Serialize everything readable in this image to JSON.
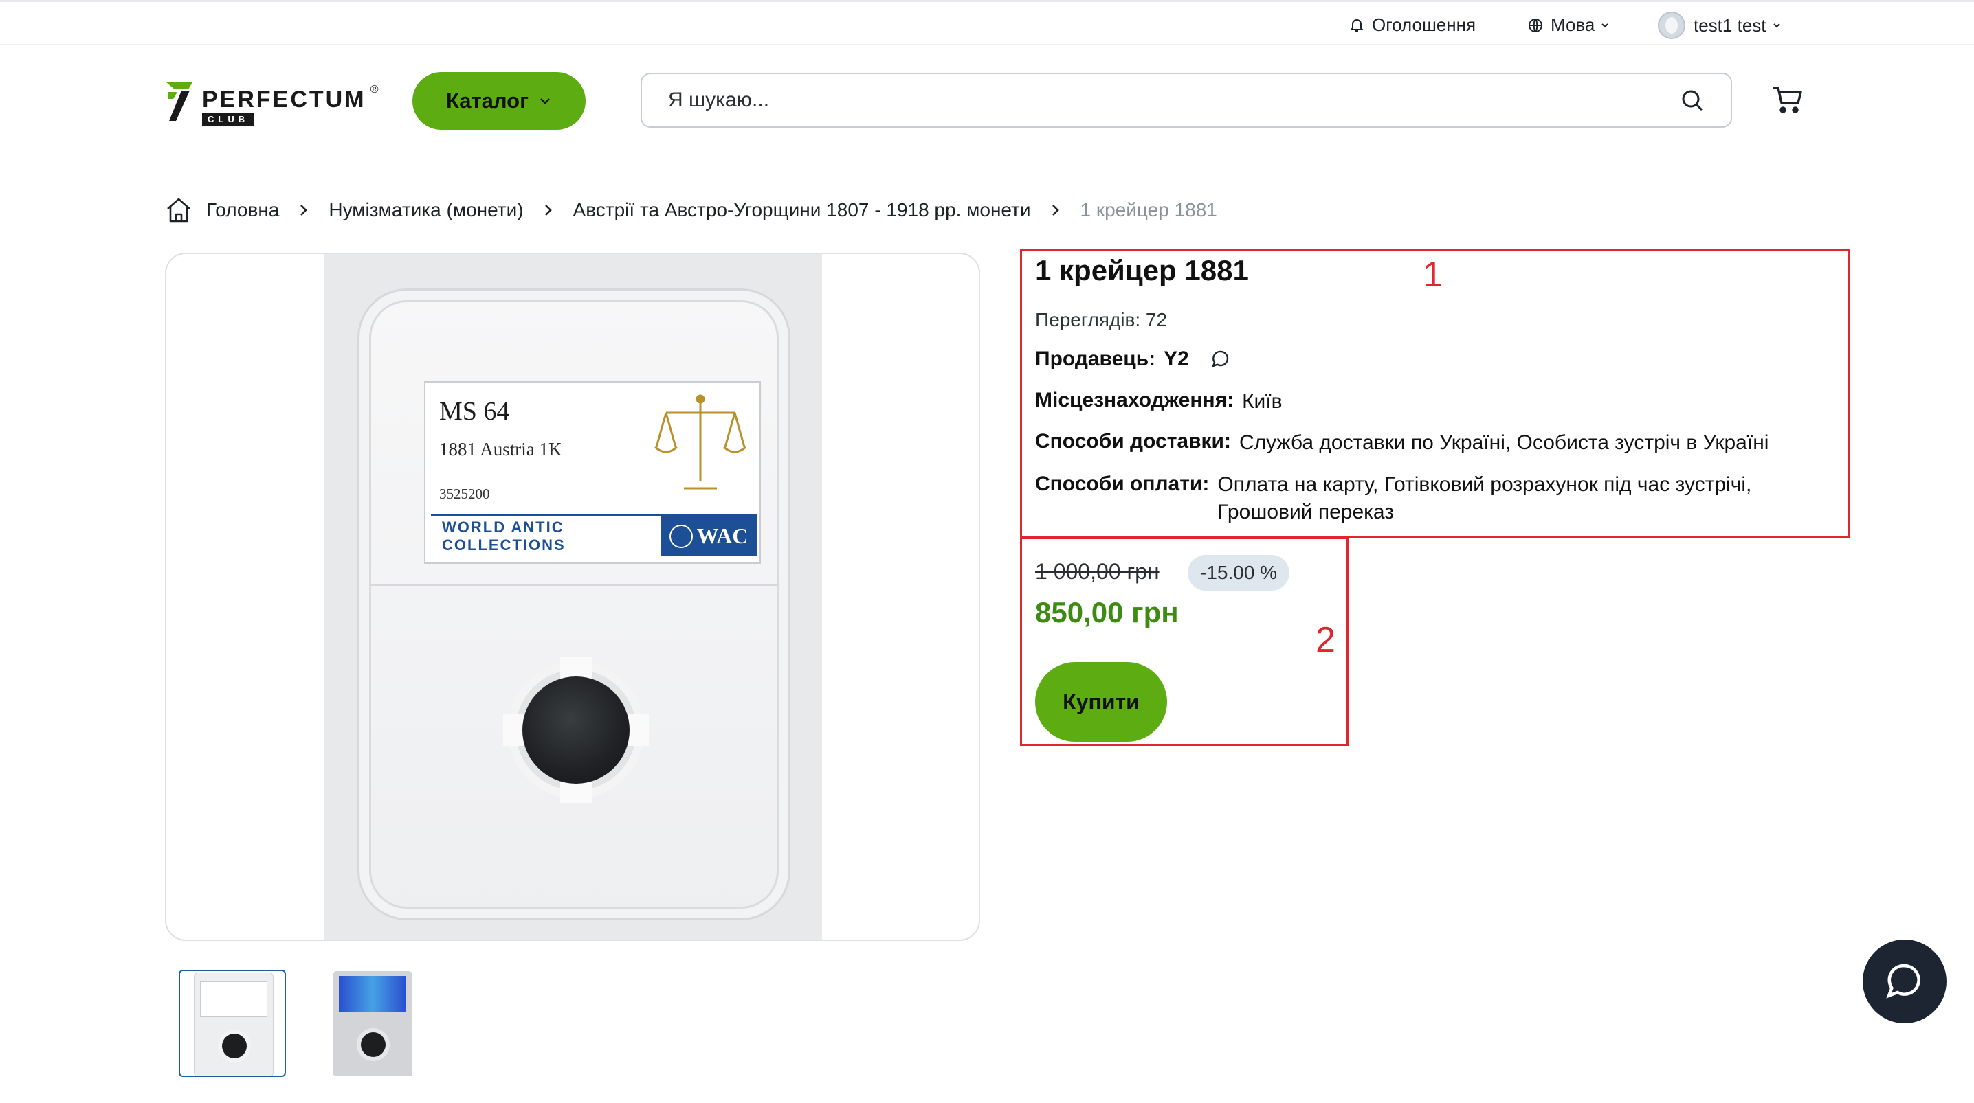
{
  "topbar": {
    "announcements": "Оголошення",
    "language": "Мова",
    "user": "test1 test"
  },
  "header": {
    "logo_word": "PERFECTUM",
    "logo_sub": "CLUB",
    "logo_reg": "®",
    "catalog_label": "Каталог",
    "search_placeholder": "Я шукаю..."
  },
  "breadcrumb": {
    "items": [
      "Головна",
      "Нумізматика (монети)",
      "Австрії та Австро-Угорщини 1807 - 1918 рр. монети",
      "1 крейцер 1881"
    ]
  },
  "gallery": {
    "slab_grade": "MS 64",
    "slab_coin": "1881 Austria 1K",
    "slab_cert": "3525200",
    "slab_band": "WORLD ANTIC COLLECTIONS",
    "slab_brand": "WAC"
  },
  "product": {
    "title": "1 крейцер 1881",
    "views": "Переглядів: 72",
    "seller_label": "Продавець:",
    "seller_value": "Y2",
    "location_label": "Місцезнаходження:",
    "location_value": "Київ",
    "delivery_label": "Способи доставки:",
    "delivery_value": "Служба доставки по Україні, Особиста зустріч в Україні",
    "payment_label": "Способи оплати:",
    "payment_line1": "Оплата на карту, Готівковий розрахунок під час зустрічі,",
    "payment_line2": "Грошовий переказ",
    "old_price": "1 000,00 грн",
    "discount": "-15.00 %",
    "new_price": "850,00 грн",
    "buy_label": "Купити"
  },
  "annotations": {
    "box1": "1",
    "box2": "2",
    "color": "#e0262f"
  },
  "colors": {
    "accent": "#5cac12",
    "price": "#3d8b12",
    "fab": "#1d2533"
  }
}
